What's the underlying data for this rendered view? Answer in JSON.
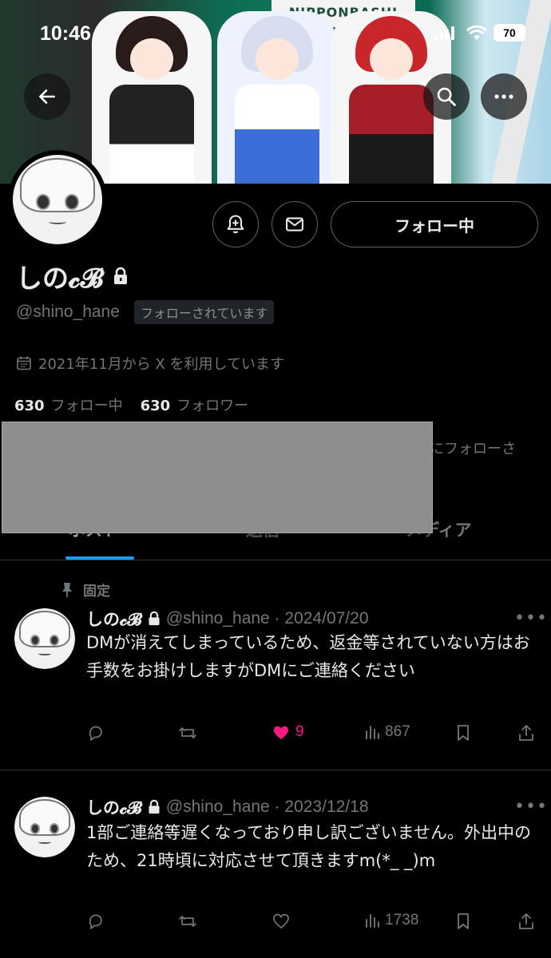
{
  "status_bar": {
    "time": "10:46",
    "battery": "70"
  },
  "banner": {
    "store_sign": "NIPPONBASHI"
  },
  "profile": {
    "display_name": "しの𝓬𝓑",
    "handle": "@shino_hane",
    "follows_you_badge": "フォローされています",
    "joined": "2021年11月から X を利用しています",
    "following_count": "630",
    "following_label": "フォロー中",
    "followers_count": "630",
    "followers_label": "フォロワー",
    "followed_by_note": "んにフォローさ"
  },
  "actions": {
    "follow_button_label": "フォロー中"
  },
  "tabs": [
    {
      "label": "ポスト"
    },
    {
      "label": "返信"
    },
    {
      "label": "メディア"
    }
  ],
  "pinned_label": "固定",
  "posts": [
    {
      "name": "しの𝓬𝓑",
      "handle_date": "@shino_hane · 2024/07/20",
      "text": "DMが消えてしまっているため、返金等されていない方はお手数をお掛けしますがDMにご連絡ください",
      "reply_count": "",
      "repost_count": "",
      "like_count": "9",
      "view_count": "867",
      "liked": true
    },
    {
      "name": "しの𝓬𝓑",
      "handle_date": "@shino_hane · 2023/12/18",
      "text": "1部ご連絡等遅くなっており申し訳ございません。外出中のため、21時頃に対応させて頂きますm(*_ _)m",
      "reply_count": "",
      "repost_count": "",
      "like_count": "",
      "view_count": "1738",
      "liked": false
    }
  ],
  "colors": {
    "accent": "#1d9bf0",
    "like": "#f91880",
    "muted": "#71767b",
    "background": "#000000"
  },
  "icons": [
    "back-arrow-icon",
    "search-icon",
    "more-icon",
    "notification-bell-plus-icon",
    "mail-icon",
    "lock-icon",
    "calendar-icon",
    "pin-icon",
    "reply-icon",
    "repost-icon",
    "like-icon",
    "views-icon",
    "bookmark-icon",
    "share-icon"
  ]
}
